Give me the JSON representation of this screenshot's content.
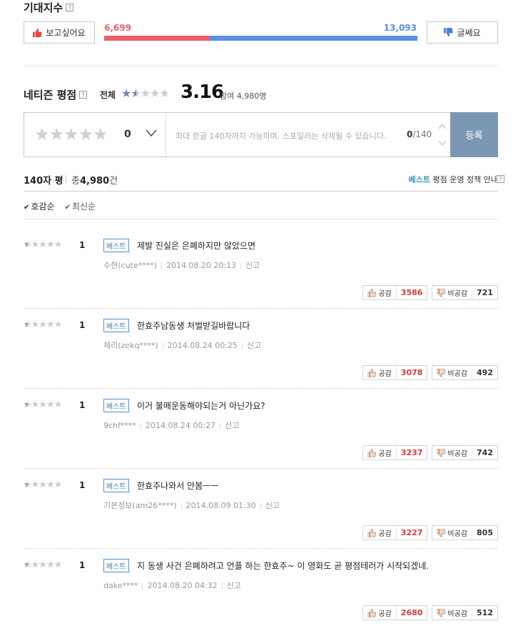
{
  "expect": {
    "title": "기대지수",
    "help_icon": "?",
    "want_label": "보고싶어요",
    "meh_label": "글쎄요",
    "want_count": "6,699",
    "meh_count": "13,093",
    "want_ratio": 0.338
  },
  "netizen": {
    "title": "네티즌 평점",
    "all_label": "전체",
    "score": "3.16",
    "participants": "참여 4,980명"
  },
  "input": {
    "score": "0",
    "placeholder": "최대 한글 140자까지 가능하며, 스포일러는 삭제될 수 있습니다.",
    "count_current": "0",
    "count_max": "/140",
    "submit_label": "등록"
  },
  "summary": {
    "type_label": "140자 평",
    "total_prefix": "총",
    "total_count": "4,980",
    "total_suffix": "건",
    "policy_best": "베스트",
    "policy_text": "평점 운영 정책 안내"
  },
  "sort": {
    "likes": "호감순",
    "latest": "최신순"
  },
  "review_common": {
    "badge": "베스트",
    "report": "신고",
    "like_label": "공감",
    "dislike_label": "비공감"
  },
  "reviews": [
    {
      "score": "1",
      "text": "제발 진실은 은폐하지만 않았으면",
      "user": "수현(cute****)",
      "date": "2014.08.20 20:13",
      "likes": "3586",
      "dislikes": "721"
    },
    {
      "score": "1",
      "text": "한효주남동생 처벌받길바랍니다",
      "user": "체리(zekq****)",
      "date": "2014.08.24 00:25",
      "likes": "3078",
      "dislikes": "492"
    },
    {
      "score": "1",
      "text": "이거 불매운동해야되는거 아닌가요?",
      "user": "9chf****",
      "date": "2014.08.24 00:27",
      "likes": "3237",
      "dislikes": "742"
    },
    {
      "score": "1",
      "text": "한효주나와서 안봄ㅡㅡ",
      "user": "기본정보(am26****)",
      "date": "2014.08.09 01:30",
      "likes": "3227",
      "dislikes": "805"
    },
    {
      "score": "1",
      "text": "지 동생 사건 은폐하려고 언플 하는 한효주~ 이 영화도 곧 평점테러가 시작되겠네.",
      "user": "dake****",
      "date": "2014.08.20 04:32",
      "likes": "2680",
      "dislikes": "512"
    }
  ],
  "colors": {
    "want": "#ea5f6a",
    "meh": "#5b8fe8",
    "submit": "#7a98b3",
    "best_badge": "#4d8fd1",
    "like_count": "#d53a3a"
  }
}
